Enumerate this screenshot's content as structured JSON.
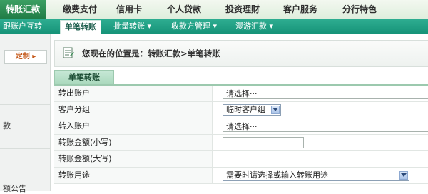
{
  "top_nav": {
    "active": "转账汇款",
    "items": [
      "缴费支付",
      "信用卡",
      "个人贷款",
      "投资理财",
      "客户服务",
      "分行特色"
    ]
  },
  "sub_nav": {
    "items": [
      "跟账户互转",
      "单笔转账",
      "批量转账 ▾",
      "收款方管理 ▾",
      "漫游汇款 ▾"
    ]
  },
  "sidebar": {
    "customize_label": "定制 ▸",
    "partial_text_1": "款",
    "partial_text_2": "额公告"
  },
  "breadcrumb": {
    "text": "您现在的位置是：转账汇款>单笔转账"
  },
  "tab_label": "单笔转账",
  "form": {
    "rows": [
      {
        "label": "转出账户",
        "value": "请选择···"
      },
      {
        "label": "客户分组",
        "value": "临时客户组"
      },
      {
        "label": "转入账户",
        "value": "请选择···"
      },
      {
        "label": "转账金额(小写)",
        "value": ""
      },
      {
        "label": "转账金额(大写)",
        "value": ""
      },
      {
        "label": "转账用途",
        "value": "需要时请选择或输入转账用途"
      }
    ]
  },
  "colors": {
    "nav_green": "#1f7c45",
    "subnav_teal": "#159277",
    "tab_green": "#a9d8bc"
  }
}
